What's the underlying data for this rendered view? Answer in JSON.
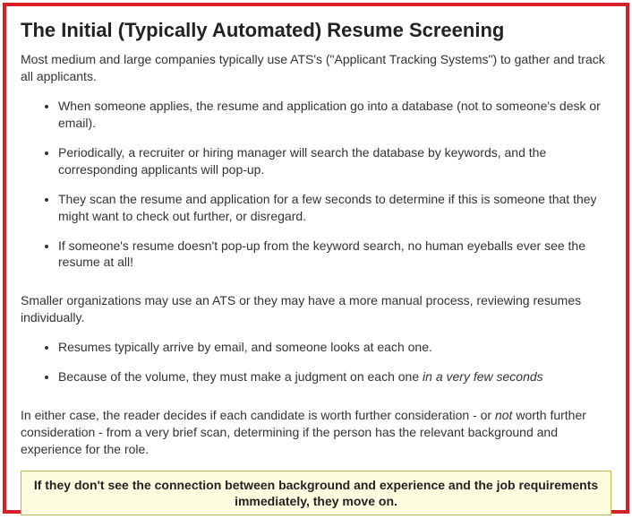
{
  "title": "The Initial (Typically Automated) Resume Screening",
  "intro": "Most medium and large companies typically use ATS's (\"Applicant Tracking Systems\") to gather and track all applicants.",
  "list1": {
    "item0": "When someone applies, the resume and application go into a database (not to someone's desk or email).",
    "item1": "Periodically, a recruiter or hiring manager will search the database by keywords, and the corresponding applicants will pop-up.",
    "item2": "They scan the resume and application for a few seconds to determine if this is someone that they might want to check out further, or disregard.",
    "item3": "If someone's resume doesn't pop-up from the keyword search, no human eyeballs ever see the resume at all!"
  },
  "para_small_orgs": "Smaller organizations may use an ATS or they may have a more manual process, reviewing resumes individually.",
  "list2": {
    "item0": "Resumes typically arrive by email, and someone looks at each one.",
    "item1_a": "Because of the volume, they must make a judgment on each one ",
    "item1_b": "in a very few seconds"
  },
  "closing": {
    "a": "In either case, the reader decides if each candidate is worth further consideration - or ",
    "b": "not",
    "c": " worth further consideration - from a very brief scan, determining if the person has the relevant background and experience for the role."
  },
  "callout": "If they don't see the connection between background and experience and the job requirements immediately, they move on."
}
